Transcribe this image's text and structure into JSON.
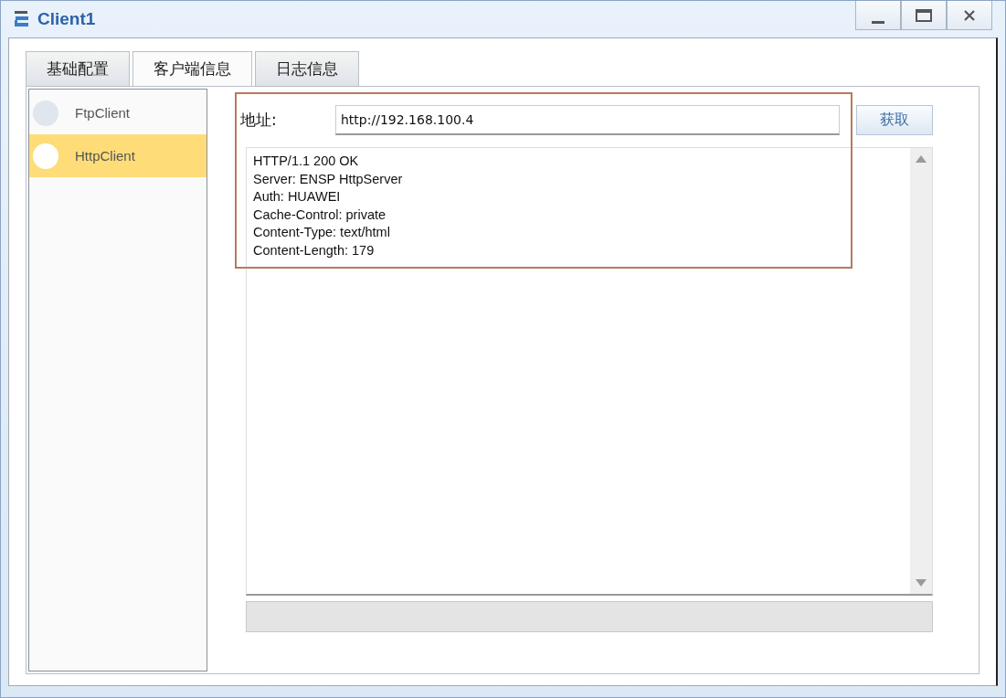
{
  "window": {
    "title": "Client1"
  },
  "tabs": [
    {
      "label": "基础配置",
      "selected": false
    },
    {
      "label": "客户端信息",
      "selected": true
    },
    {
      "label": "日志信息",
      "selected": false
    }
  ],
  "clients": [
    {
      "label": "FtpClient",
      "selected": false
    },
    {
      "label": "HttpClient",
      "selected": true
    }
  ],
  "address": {
    "label": "地址:",
    "value": "http://192.168.100.4"
  },
  "fetch_button": "获取",
  "response_lines": [
    "HTTP/1.1 200 OK",
    "Server: ENSP HttpServer",
    "Auth: HUAWEI",
    "Cache-Control: private",
    "Content-Type: text/html",
    "Content-Length: 179"
  ],
  "annotation": {
    "kind": "box",
    "color": "#b87a5a"
  }
}
